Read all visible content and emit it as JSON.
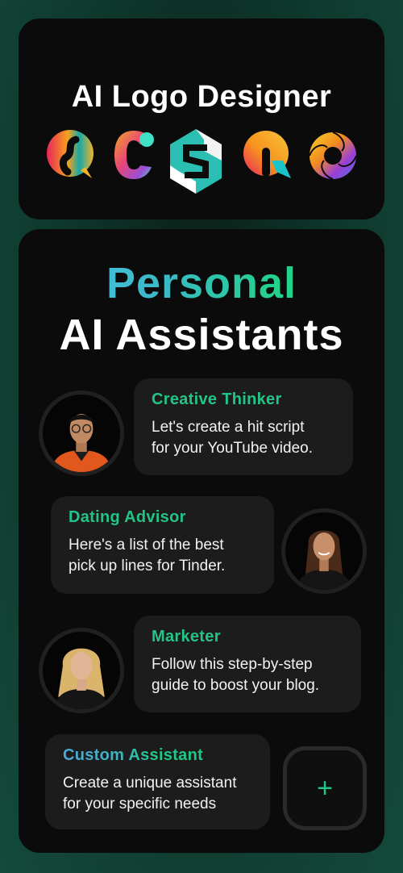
{
  "logo_designer": {
    "title": "AI Logo Designer",
    "logos": [
      "q-chat-logo",
      "c-gradient-logo",
      "s-hexagon-logo",
      "q-bubble-logo",
      "swirl-logo"
    ]
  },
  "assistants_section": {
    "heading_line1": "Personal",
    "heading_line2": "AI Assistants",
    "heading_gradient": [
      "#4ac3ec",
      "#1fcf88"
    ],
    "accent_color": "#23c488",
    "items": [
      {
        "name": "Creative Thinker",
        "message": "Let's create a hit script for your YouTube video.",
        "line1": "Let's create a hit script",
        "line2": "for your YouTube video.",
        "avatar": "man-orange-jacket-avatar"
      },
      {
        "name": "Dating Advisor",
        "message": "Here's a list of the best pick up lines for Tinder.",
        "line1": "Here's a list of the best",
        "line2": "pick up lines for Tinder.",
        "avatar": "woman-brunette-avatar"
      },
      {
        "name": "Marketer",
        "message": "Follow this step-by-step guide to boost your blog.",
        "line1": "Follow this step-by-step",
        "line2": "guide to boost your blog.",
        "avatar": "woman-blonde-avatar"
      }
    ],
    "custom": {
      "name": "Custom Assistant",
      "line1": "Create a unique assistant",
      "line2": "for your specific needs",
      "button_icon": "+"
    }
  }
}
